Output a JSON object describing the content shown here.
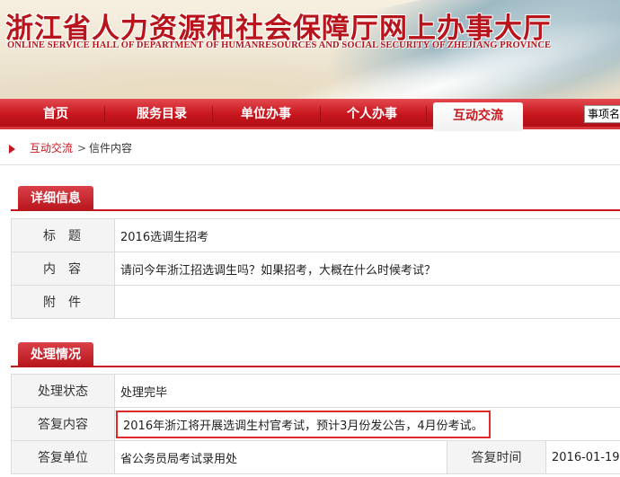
{
  "banner": {
    "title": "浙江省人力资源和社会保障厅网上办事大厅",
    "subtitle": "ONLINE SERVICE HALL OF DEPARTMENT OF HUMANRESOURCES AND SOCIAL SECURITY OF ZHEJIANG PROVINCE"
  },
  "nav": {
    "items": [
      "首页",
      "服务目录",
      "单位办事",
      "个人办事"
    ],
    "active": "互动交流",
    "search_value": "事项名"
  },
  "breadcrumb": {
    "link": "互动交流",
    "separator": ">",
    "current": "信件内容"
  },
  "detail": {
    "heading": "详细信息",
    "rows": [
      {
        "label": "标题",
        "value": "2016选调生招考"
      },
      {
        "label": "内容",
        "value": "请问今年浙江招选调生吗？如果招考，大概在什么时候考试？"
      },
      {
        "label": "附件",
        "value": ""
      }
    ]
  },
  "process": {
    "heading": "处理情况",
    "status_label": "处理状态",
    "status_value": "处理完毕",
    "reply_label": "答复内容",
    "reply_value": "2016年浙江将开展选调生村官考试，预计3月份发公告，4月份考试。",
    "unit_label": "答复单位",
    "unit_value": "省公务员局考试录用处",
    "time_label": "答复时间",
    "time_value": "2016-01-19"
  }
}
